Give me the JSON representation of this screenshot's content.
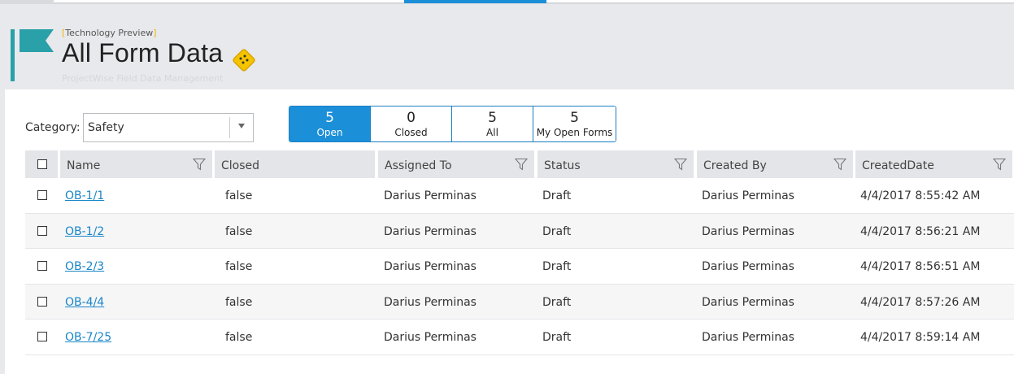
{
  "header": {
    "tag": "Technology Preview",
    "title": "All Form Data",
    "subtitle": "ProjectWise Field Data Management"
  },
  "category": {
    "label": "Category:",
    "value": "Safety"
  },
  "filters": [
    {
      "count": "5",
      "label": "Open",
      "active": true
    },
    {
      "count": "0",
      "label": "Closed",
      "active": false
    },
    {
      "count": "5",
      "label": "All",
      "active": false
    },
    {
      "count": "5",
      "label": "My Open Forms",
      "active": false
    }
  ],
  "table": {
    "columns": [
      "Name",
      "Closed",
      "Assigned To",
      "Status",
      "Created By",
      "CreatedDate"
    ],
    "rows": [
      {
        "name": "OB-1/1",
        "closed": "false",
        "assigned_to": "Darius Perminas",
        "status": "Draft",
        "created_by": "Darius Perminas",
        "created_date": "4/4/2017 8:55:42 AM"
      },
      {
        "name": "OB-1/2",
        "closed": "false",
        "assigned_to": "Darius Perminas",
        "status": "Draft",
        "created_by": "Darius Perminas",
        "created_date": "4/4/2017 8:56:21 AM"
      },
      {
        "name": "OB-2/3",
        "closed": "false",
        "assigned_to": "Darius Perminas",
        "status": "Draft",
        "created_by": "Darius Perminas",
        "created_date": "4/4/2017 8:56:51 AM"
      },
      {
        "name": "OB-4/4",
        "closed": "false",
        "assigned_to": "Darius Perminas",
        "status": "Draft",
        "created_by": "Darius Perminas",
        "created_date": "4/4/2017 8:57:26 AM"
      },
      {
        "name": "OB-7/25",
        "closed": "false",
        "assigned_to": "Darius Perminas",
        "status": "Draft",
        "created_by": "Darius Perminas",
        "created_date": "4/4/2017 8:59:14 AM"
      }
    ]
  },
  "icons": {
    "brand": "flag-icon",
    "preview": "preview-badge-icon",
    "column_filter": "filter-icon",
    "dropdown": "chevron-down-icon"
  },
  "colors": {
    "accent": "#1c8fd9",
    "brand_teal": "#2aa0a8",
    "link": "#1a86c8",
    "badge": "#f5c400"
  }
}
